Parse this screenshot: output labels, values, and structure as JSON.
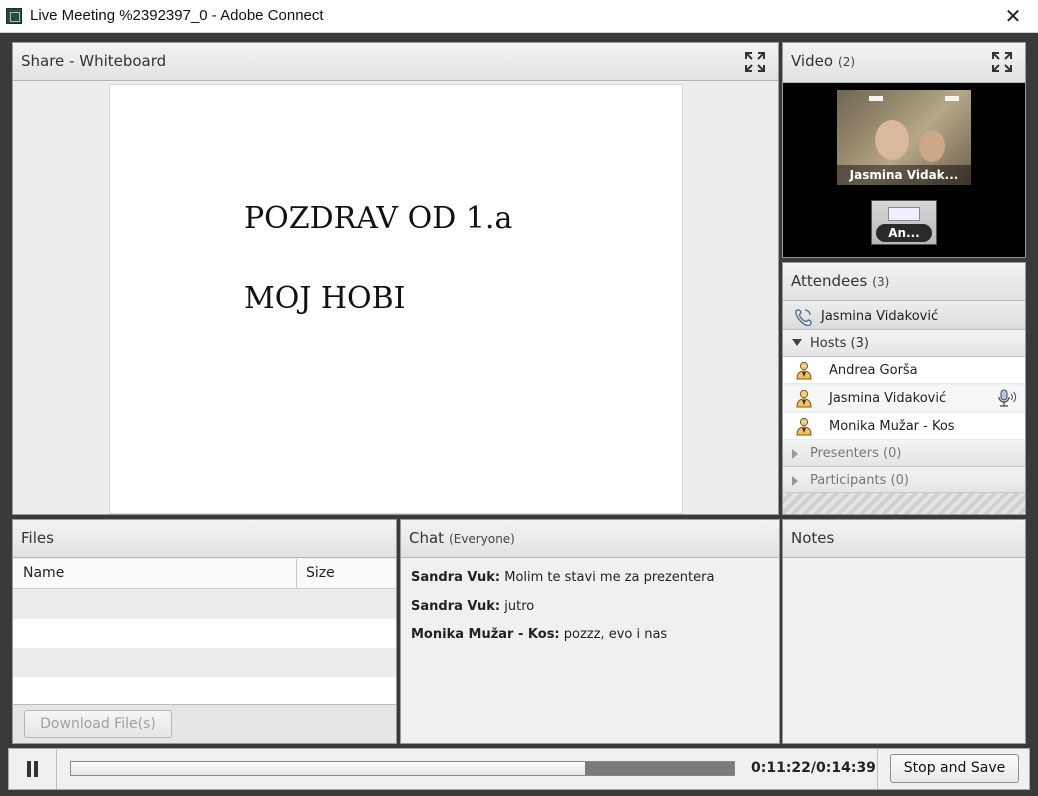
{
  "window": {
    "title": "Live Meeting %2392397_0 - Adobe Connect",
    "close_glyph": "✕"
  },
  "share": {
    "title": "Share - Whiteboard",
    "lines": [
      "POZDRAV OD 1.a",
      "MOJ HOBI"
    ]
  },
  "video": {
    "title": "Video",
    "count": "(2)",
    "main_name": "Jasmina Vidak...",
    "small_name": "An..."
  },
  "attendees": {
    "title": "Attendees",
    "count": "(3)",
    "me": "Jasmina Vidaković",
    "hosts_label": "Hosts (3)",
    "hosts": [
      "Andrea Gorša",
      "Jasmina Vidaković",
      "Monika Mužar - Kos"
    ],
    "presenters_label": "Presenters (0)",
    "participants_label": "Participants (0)"
  },
  "files": {
    "title": "Files",
    "columns": [
      "Name",
      "Size"
    ],
    "download_label": "Download File(s)"
  },
  "chat": {
    "title": "Chat",
    "scope": "(Everyone)",
    "messages": [
      {
        "sender": "Sandra Vuk:",
        "text": " Molim te stavi me za prezentera"
      },
      {
        "sender": "Sandra Vuk:",
        "text": " jutro"
      },
      {
        "sender": "Monika Mužar - Kos:",
        "text": " pozzz, evo i nas"
      }
    ]
  },
  "notes": {
    "title": "Notes"
  },
  "playback": {
    "time": "0:11:22/0:14:39",
    "progress_fraction": 0.776,
    "stop_label": "Stop and Save"
  },
  "colors": {
    "pod_header": "#e6e6e6",
    "video_bg": "#000000",
    "text": "#222222"
  }
}
